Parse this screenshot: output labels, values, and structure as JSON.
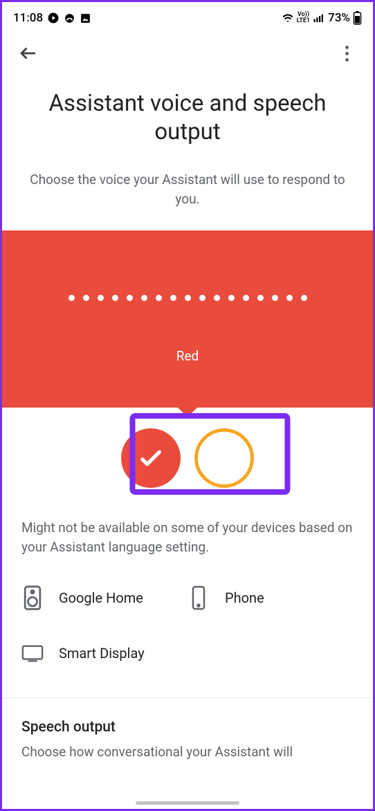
{
  "status": {
    "time": "11:08",
    "battery": "73%",
    "network_label": "Vo))\nLTE1"
  },
  "header": {
    "title": "Assistant voice and speech output",
    "subtitle": "Choose the voice your Assistant will use to respond to you."
  },
  "voice": {
    "current_label": "Red",
    "swatches": [
      "red",
      "orange"
    ]
  },
  "note": "Might not be available on some of your devices based on your Assistant language setting.",
  "devices": {
    "home": "Google Home",
    "phone": "Phone",
    "display": "Smart Display"
  },
  "sections": {
    "speech_title": "Speech output",
    "speech_sub": "Choose how conversational your Assistant will"
  }
}
